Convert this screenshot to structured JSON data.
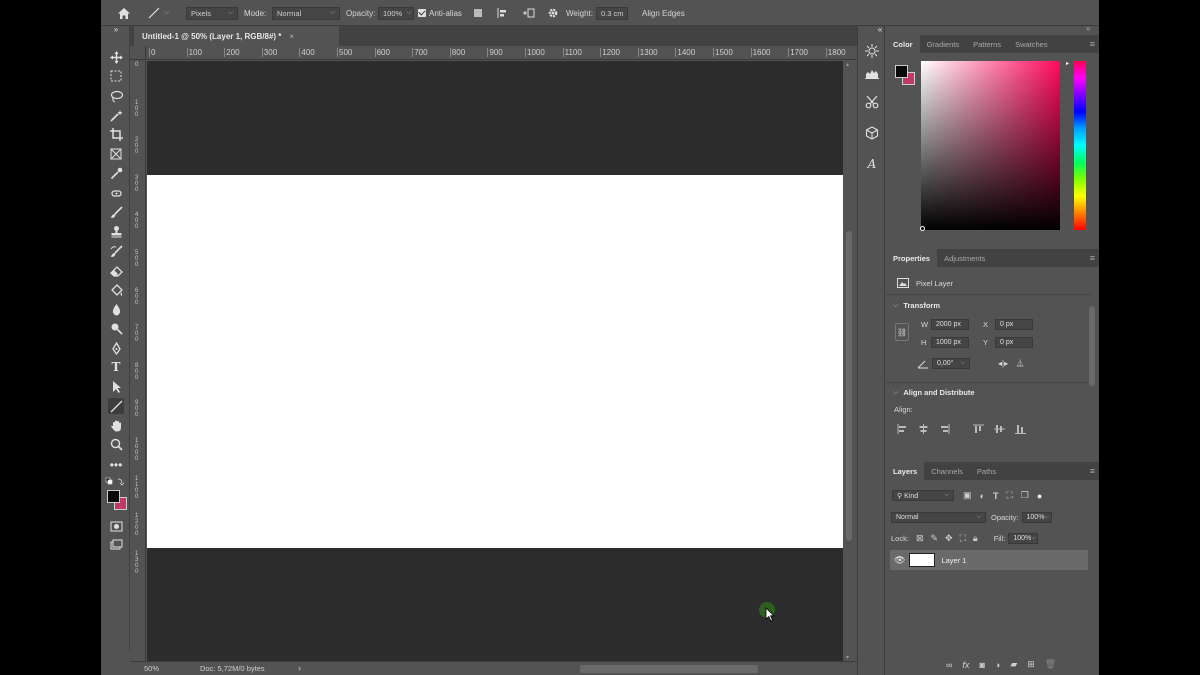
{
  "options_bar": {
    "pixels": "Pixels",
    "mode_label": "Mode:",
    "mode_value": "Normal",
    "opacity_label": "Opacity:",
    "opacity_value": "100%",
    "antialias_label": "Anti-alias",
    "weight_label": "Weight:",
    "weight_value": "0.3 cm",
    "align_edges": "Align Edges"
  },
  "document_tab": {
    "title": "Untitled-1 @ 50% (Layer 1, RGB/8#) *",
    "close": "×"
  },
  "ruler_top": [
    "0",
    "100",
    "200",
    "300",
    "400",
    "500",
    "600",
    "700",
    "800",
    "900",
    "1000",
    "1100",
    "1200",
    "1300",
    "1400",
    "1500",
    "1600",
    "1700",
    "1800"
  ],
  "ruler_left": [
    "0",
    "1\n0\n0",
    "2\n0\n0",
    "3\n0\n0",
    "4\n0\n0",
    "5\n0\n0",
    "6\n0\n0",
    "7\n0\n0",
    "8\n0\n0",
    "9\n0\n0",
    "1\n0\n0\n0",
    "1\n1\n0\n0",
    "1\n2\n0\n0",
    "1\n3\n0\n0"
  ],
  "status_bar": {
    "zoom": "50%",
    "doc": "Doc: 5,72M/0 bytes",
    "arrow": "›"
  },
  "color_panel": {
    "tabs": [
      "Color",
      "Gradients",
      "Patterns",
      "Swatches"
    ],
    "fg": "#0a0a0a",
    "bg": "#c1396a"
  },
  "properties_panel": {
    "tabs": [
      "Properties",
      "Adjustments"
    ],
    "layer_type": "Pixel Layer",
    "transform_title": "Transform",
    "w_label": "W",
    "w_value": "2000 px",
    "x_label": "X",
    "x_value": "0 px",
    "h_label": "H",
    "h_value": "1000 px",
    "y_label": "Y",
    "y_value": "0 px",
    "angle_value": "0,00°",
    "align_title": "Align and Distribute",
    "align_label": "Align:"
  },
  "layers_panel": {
    "tabs": [
      "Layers",
      "Channels",
      "Paths"
    ],
    "kind": "Kind",
    "blend_mode": "Normal",
    "opacity_label": "Opacity:",
    "opacity_value": "100%",
    "lock_label": "Lock:",
    "fill_label": "Fill:",
    "fill_value": "100%",
    "layer_name": "Layer 1"
  }
}
